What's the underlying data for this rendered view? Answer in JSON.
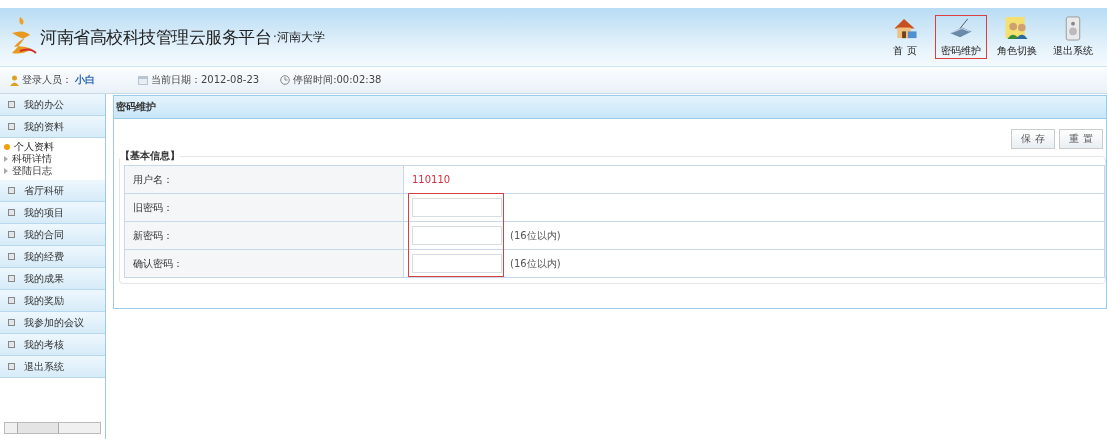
{
  "header": {
    "title": "河南省高校科技管理云服务平台",
    "subtitle": "·河南大学"
  },
  "nav": [
    {
      "kind": "home",
      "label": "首 页",
      "selected": false
    },
    {
      "kind": "password",
      "label": "密码维护",
      "selected": true
    },
    {
      "kind": "role",
      "label": "角色切换",
      "selected": false
    },
    {
      "kind": "exit",
      "label": "退出系统",
      "selected": false
    }
  ],
  "info_bar": {
    "user_label": "登录人员：",
    "user_name": "小白",
    "date": "当前日期：2012-08-23",
    "stay": "停留时间:00:02:38"
  },
  "sidebar": [
    {
      "label": "我的办公"
    },
    {
      "label": "我的资料",
      "children": [
        {
          "label": "个人资料",
          "selected": true
        },
        {
          "label": "科研详情",
          "selected": false
        },
        {
          "label": "登陆日志",
          "selected": false
        }
      ]
    },
    {
      "label": "省厅科研"
    },
    {
      "label": "我的项目"
    },
    {
      "label": "我的合同"
    },
    {
      "label": "我的经费"
    },
    {
      "label": "我的成果"
    },
    {
      "label": "我的奖励"
    },
    {
      "label": "我参加的会议"
    },
    {
      "label": "我的考核"
    },
    {
      "label": "退出系统"
    }
  ],
  "panel": {
    "title": "密码维护",
    "buttons": [
      "保 存",
      "重 置"
    ],
    "legend": "【基本信息】",
    "rows": [
      {
        "kind": "text",
        "label": "用户名：",
        "value": "110110"
      },
      {
        "kind": "input",
        "label": "旧密码："
      },
      {
        "kind": "input",
        "label": "新密码：",
        "hint": "(16位以内)"
      },
      {
        "kind": "input",
        "label": "确认密码：",
        "hint": "(16位以内)"
      }
    ],
    "inputs_highlighted": true
  }
}
